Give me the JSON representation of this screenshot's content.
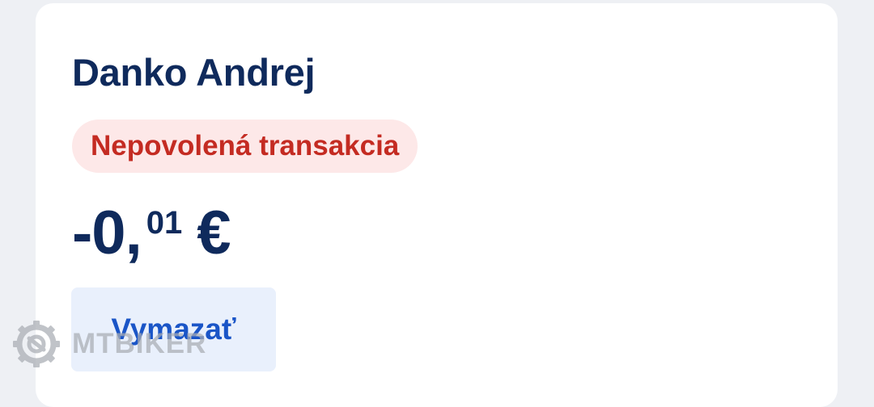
{
  "transaction": {
    "name": "Danko Andrej",
    "status": "Nepovolená transakcia",
    "amount_main": "-0,",
    "amount_cents": "01",
    "currency": "€"
  },
  "actions": {
    "delete_label": "Vymazať"
  },
  "watermark": {
    "text": "MTBIKER",
    "icon": "gear-icon"
  },
  "colors": {
    "background": "#eef0f4",
    "card": "#ffffff",
    "title_navy": "#0f2a5c",
    "status_red": "#c42b22",
    "status_bg": "#fde8e8",
    "button_bg": "#e9f0fc",
    "button_text": "#1a55c7"
  }
}
